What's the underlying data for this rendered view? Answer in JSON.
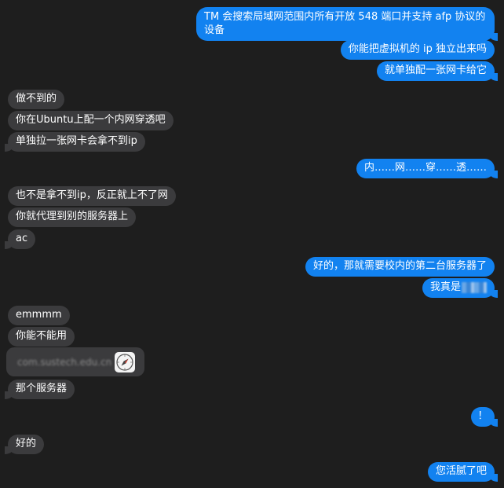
{
  "conversation": {
    "messages": [
      {
        "side": "out",
        "text": "TM 会搜索局域网范围内所有开放 548 端口并支持 afp 协议的设备"
      },
      {
        "side": "out",
        "text": "你能把虚拟机的 ip 独立出来吗"
      },
      {
        "side": "out",
        "text": "就单独配一张网卡给它"
      },
      {
        "side": "in",
        "text": "做不到的"
      },
      {
        "side": "in",
        "text": "你在Ubuntu上配一个内网穿透吧"
      },
      {
        "side": "in",
        "text": "单独拉一张网卡会拿不到ip"
      },
      {
        "side": "out",
        "text": "内……网……穿……透……"
      },
      {
        "side": "in",
        "text": "也不是拿不到ip，反正就上不了网"
      },
      {
        "side": "in",
        "text": "你就代理到别的服务器上"
      },
      {
        "side": "in",
        "text": "ac"
      },
      {
        "side": "out",
        "text": "好的，那就需要校内的第二台服务器了"
      },
      {
        "side": "out",
        "text": "我真是"
      },
      {
        "side": "in",
        "text": "emmmm"
      },
      {
        "side": "in",
        "text": "你能不能用"
      },
      {
        "side": "in",
        "text": "com.sustech.edu.cn"
      },
      {
        "side": "in",
        "text": "那个服务器"
      },
      {
        "side": "out",
        "text": "！"
      },
      {
        "side": "in",
        "text": "好的"
      },
      {
        "side": "out",
        "text": "您活腻了吧"
      }
    ]
  },
  "icons": {
    "link_preview": "safari-compass-icon"
  },
  "colors": {
    "outgoing": "#1282f0",
    "incoming": "#3b3b3d",
    "background": "#1e1e1e"
  }
}
